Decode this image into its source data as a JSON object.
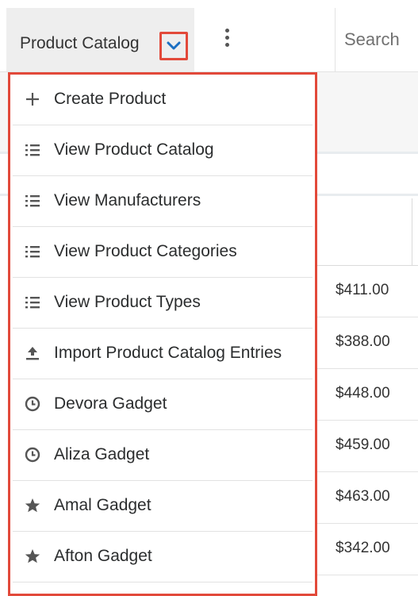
{
  "header": {
    "module_label": "Product Catalog",
    "search_placeholder": "Search"
  },
  "colors": {
    "highlight": "#e2493a",
    "toggle_chevron": "#1b6fc2",
    "icon": "#555555"
  },
  "menu": {
    "items": [
      {
        "label": "Create Product",
        "icon": "plus-icon"
      },
      {
        "label": "View Product Catalog",
        "icon": "list-icon"
      },
      {
        "label": "View Manufacturers",
        "icon": "list-icon"
      },
      {
        "label": "View Product Categories",
        "icon": "list-icon"
      },
      {
        "label": "View Product Types",
        "icon": "list-icon"
      },
      {
        "label": "Import Product Catalog Entries",
        "icon": "upload-icon"
      },
      {
        "label": "Devora Gadget",
        "icon": "clock-icon"
      },
      {
        "label": "Aliza Gadget",
        "icon": "clock-icon"
      },
      {
        "label": "Amal Gadget",
        "icon": "star-icon"
      },
      {
        "label": "Afton Gadget",
        "icon": "star-icon"
      }
    ]
  },
  "list": {
    "prices": [
      "$411.00",
      "$388.00",
      "$448.00",
      "$459.00",
      "$463.00",
      "$342.00"
    ]
  }
}
